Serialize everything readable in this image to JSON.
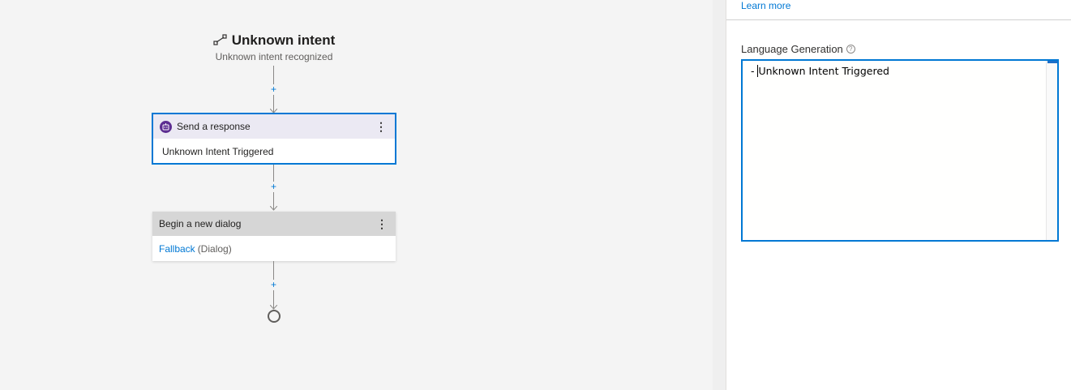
{
  "trigger": {
    "title": "Unknown intent",
    "subtitle": "Unknown intent recognized",
    "icon": "flow-icon"
  },
  "nodes": [
    {
      "header": "Send a response",
      "icon": "bot-icon",
      "body": "Unknown Intent Triggered",
      "selected": true
    },
    {
      "header": "Begin a new dialog",
      "body_link": "Fallback",
      "body_suffix": "(Dialog)",
      "selected": false
    }
  ],
  "add_button_glyph": "+",
  "menu_glyph": "⋮",
  "panel": {
    "learn_more": "Learn more",
    "field_label": "Language Generation",
    "help_glyph": "?",
    "editor": {
      "prefix": "- ",
      "text": "Unknown Intent Triggered"
    }
  },
  "colors": {
    "accent": "#0078d4",
    "bot_icon": "#5c2d91",
    "send_header": "#ebe9f3",
    "dialog_header": "#d6d6d6",
    "canvas_bg": "#f4f4f4"
  }
}
